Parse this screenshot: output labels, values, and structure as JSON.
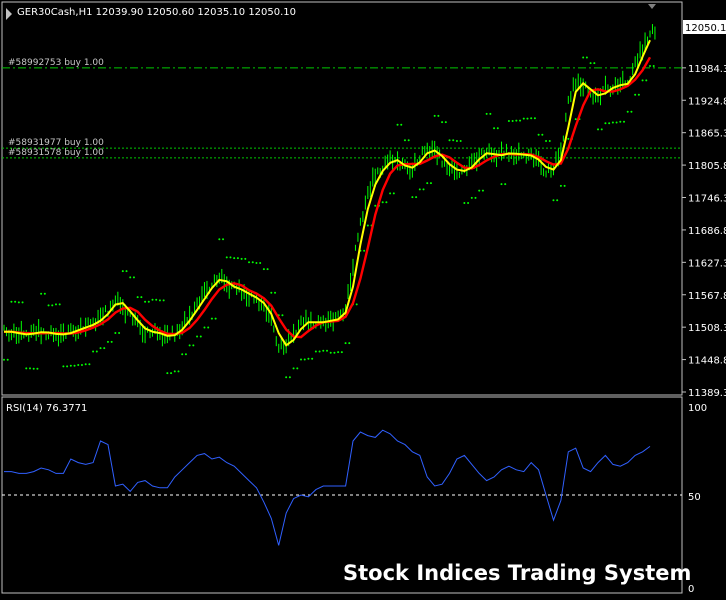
{
  "main_panel": {
    "header": "GER30Cash,H1  12039.90 12050.60 12035.10 12050.10",
    "price_axis": [
      "12050.1",
      "11984.3",
      "11924.8",
      "11865.3",
      "11805.8",
      "11746.3",
      "11686.8",
      "11627.3",
      "11567.8",
      "11508.3",
      "11448.8",
      "11389.3"
    ],
    "orders": [
      {
        "label": "#58992753 buy 1.00",
        "price": 11984.3
      },
      {
        "label": "#58931977 buy 1.00",
        "price": 11837.0
      },
      {
        "label": "#58931578 buy 1.00",
        "price": 11819.0
      }
    ],
    "current_price_label": "12050.1"
  },
  "rsi_panel": {
    "header": "RSI(14) 76.3771",
    "axis_labels": [
      "100",
      "50",
      "0"
    ]
  },
  "watermark": "Stock Indices Trading System",
  "colors": {
    "background": "#000000",
    "candles": "#00ff00",
    "fast_ma": "#ffff00",
    "slow_ma": "#ff0000",
    "psar": "#00ff00",
    "order_line": "#00c800",
    "rsi_line": "#3060ff",
    "axis_text": "#ffffff",
    "grid_line": "#ffffff"
  },
  "chart_data": {
    "type": "line",
    "ylim": [
      11389.3,
      12050.1
    ],
    "series": [
      {
        "name": "",
        "values": [
          11500,
          11500,
          11495,
          11495,
          11498,
          11500,
          11497,
          11495,
          11495,
          11500,
          11505,
          11510,
          11515,
          11525,
          11540,
          11560,
          11545,
          11530,
          11512,
          11500,
          11500,
          11495,
          11490,
          11497,
          11510,
          11530,
          11550,
          11570,
          11590,
          11600,
          11585,
          11580,
          11575,
          11565,
          11560,
          11545,
          11520,
          11475,
          11475,
          11495,
          11515,
          11520,
          11515,
          11520,
          11520,
          11525,
          11545,
          11620,
          11700,
          11750,
          11790,
          11800,
          11820,
          11810,
          11800,
          11802,
          11820,
          11835,
          11830,
          11815,
          11800,
          11795,
          11795,
          11808,
          11825,
          11830,
          11822,
          11826,
          11828,
          11825,
          11825,
          11822,
          11810,
          11795,
          11800,
          11830,
          11920,
          11960,
          11952,
          11938,
          11930,
          11945,
          11950,
          11955,
          11955,
          11990,
          12020,
          12050
        ]
      },
      {
        "name": "RSI(14)",
        "values": [
          63,
          63,
          62,
          62,
          63,
          65,
          64,
          62,
          62,
          70,
          68,
          67,
          68,
          80,
          78,
          55,
          56,
          52,
          57,
          58,
          55,
          54,
          54,
          60,
          64,
          68,
          72,
          73,
          70,
          71,
          68,
          66,
          62,
          58,
          54,
          46,
          37,
          22,
          40,
          48,
          50,
          49,
          53,
          55,
          55,
          55,
          55,
          80,
          85,
          83,
          82,
          86,
          84,
          80,
          78,
          74,
          72,
          60,
          55,
          56,
          62,
          70,
          72,
          67,
          62,
          58,
          60,
          64,
          66,
          64,
          63,
          68,
          64,
          50,
          36,
          47,
          74,
          76,
          65,
          63,
          68,
          72,
          67,
          66,
          68,
          72,
          74,
          77
        ]
      }
    ]
  }
}
